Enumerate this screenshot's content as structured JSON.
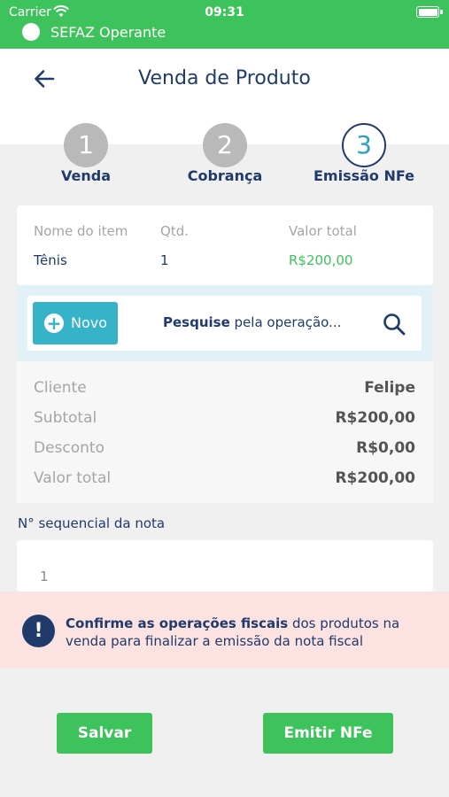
{
  "status_bar": {
    "carrier": "Carrier",
    "time": "09:31",
    "sefaz_status": "SEFAZ Operante",
    "battery_level": 1.0
  },
  "header": {
    "title": "Venda de Produto",
    "back_icon": "arrow-left-icon"
  },
  "stepper": {
    "steps": [
      {
        "number": "1",
        "label": "Venda",
        "state": "done"
      },
      {
        "number": "2",
        "label": "Cobrança",
        "state": "done"
      },
      {
        "number": "3",
        "label": "Emissão NFe",
        "state": "active"
      }
    ]
  },
  "items_table": {
    "columns": [
      "Nome do item",
      "Qtd.",
      "Valor total"
    ],
    "rows": [
      {
        "name": "Tênis",
        "qty": "1",
        "total": "R$200,00"
      }
    ]
  },
  "search": {
    "new_button_label": "Novo",
    "placeholder_bold": "Pesquise",
    "placeholder_rest": " pela operação...",
    "icon": "search-icon"
  },
  "summary": {
    "rows": [
      {
        "label": "Cliente",
        "value": "Felipe"
      },
      {
        "label": "Subtotal",
        "value": "R$200,00"
      },
      {
        "label": "Desconto",
        "value": "R$0,00"
      },
      {
        "label": "Valor total",
        "value": "R$200,00"
      }
    ]
  },
  "sequence": {
    "label": "N° sequencial da nota",
    "value": "1"
  },
  "alert": {
    "bold_text": "Confirme as operações fiscais",
    "text": " dos produtos na venda para finalizar a emissão da nota fiscal",
    "icon": "exclamation-icon"
  },
  "actions": {
    "save_label": "Salvar",
    "emit_label": "Emitir NFe"
  },
  "colors": {
    "brand_green": "#3ec25b",
    "navy": "#1f3a6b",
    "teal": "#36b2c9",
    "alert_bg": "#fde2e2"
  }
}
